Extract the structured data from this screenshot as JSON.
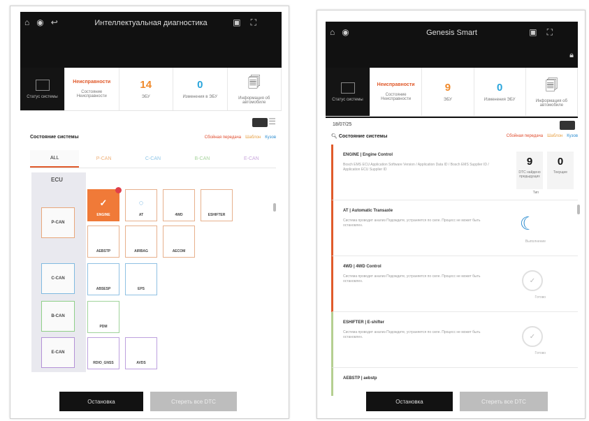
{
  "left": {
    "title": "Интеллектуальная диагностика",
    "status": {
      "system_label": "Статус системы",
      "alert_title": "Неисправности",
      "alert_sub": "Состояние Неисправности",
      "ecu_count": "14",
      "ecu_label": "ЭБУ",
      "changes_count": "0",
      "changes_label": "Изменения в ЭБУ",
      "info_label": "Информация об автомобиле"
    },
    "section_title": "Состояние системы",
    "filters": {
      "error": "Сбойная передача",
      "warn": "Шаблон",
      "ok": "Кузов"
    },
    "tabs": [
      "ALL",
      "P-CAN",
      "C-CAN",
      "B-CAN",
      "E-CAN"
    ],
    "ecu_title": "ECU",
    "cans": [
      "P-CAN",
      "C-CAN",
      "B-CAN",
      "E-CAN"
    ],
    "nodes": {
      "engine": "ENGINE",
      "at": "AT",
      "4WD": "4WD",
      "eshifter": "ESHIFTER",
      "aebstp": "AEBSTP",
      "airbag": "AIRBAG",
      "aecom": "AECOM",
      "abs": "ABSESP",
      "eps": "EPS",
      "pdm": "PDM",
      "radio": "RDIO_GNSS",
      "avs": "AVDS"
    },
    "buttons": {
      "stop": "Остановка",
      "clear": "Стереть все DTC"
    }
  },
  "right": {
    "title": "Genesis Smart",
    "status": {
      "system_label": "Статус системы",
      "alert_title": "Неисправности",
      "alert_sub": "Состояние Неисправности",
      "ecu_count": "9",
      "ecu_label": "ЭБУ",
      "changes_count": "0",
      "changes_label": "Изменения ЭБУ",
      "info_label": "Информация об автомобиле"
    },
    "vin": "18/07/25",
    "section_title": "Состояние системы",
    "filters": {
      "error": "Сбойная передача",
      "warn": "Шаблон",
      "ok": "Кузов"
    },
    "cards": [
      {
        "title": "ENGINE | Engine Control",
        "desc": "Bosch EMS ECU Application Software Version / Application Data ID / Bosch EMS Supplier ID / Application ECU Supplier ID",
        "count1": "9",
        "count1_label": "DTC найдено предыдущих",
        "count2": "0",
        "count2_label": "Текущие",
        "unit": "Тип"
      },
      {
        "title": "AT | Automatic Transaxle",
        "desc": "Система проводит анализ Подождите, устраняется по силе. Процесс не может быть остановлен.",
        "status": "Выполнение"
      },
      {
        "title": "4WD | 4WD Control",
        "desc": "Система проводит анализ Подождите, устраняется по силе. Процесс не может быть остановлен.",
        "status": "Готово"
      },
      {
        "title": "ESHIFTER | E-shifter",
        "desc": "Система проводит анализ Подождите, устраняется по силе. Процесс не может быть остановлен.",
        "status": "Готово"
      },
      {
        "title": "AEBSTP | aebstp",
        "desc": "",
        "status": ""
      }
    ],
    "buttons": {
      "stop": "Остановка",
      "clear": "Стереть все DTC"
    }
  }
}
